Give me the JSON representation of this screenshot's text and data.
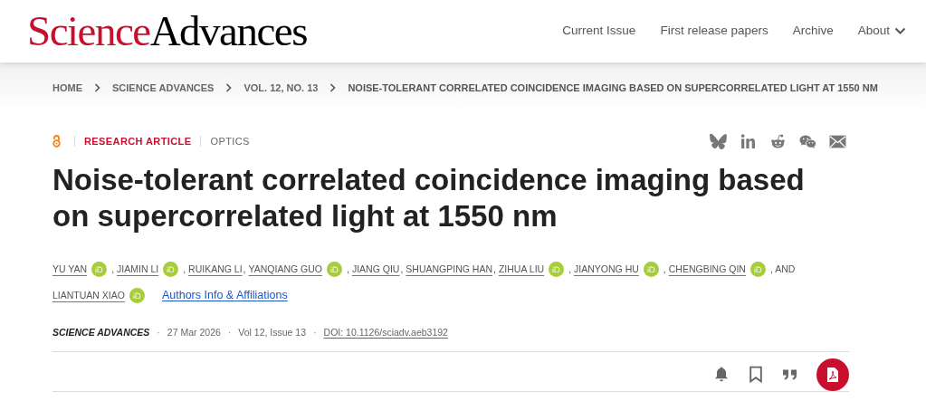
{
  "logo": {
    "part_1": "Science",
    "part_2": "Advances"
  },
  "nav": [
    {
      "label": "Current Issue",
      "kind": "link"
    },
    {
      "label": "First release papers",
      "kind": "link"
    },
    {
      "label": "Archive",
      "kind": "link"
    },
    {
      "label": "About",
      "kind": "dropdown"
    }
  ],
  "breadcrumbs": [
    "HOME",
    "SCIENCE ADVANCES",
    "VOL. 12, NO. 13",
    "NOISE-TOLERANT CORRELATED COINCIDENCE IMAGING BASED ON SUPERCORRELATED LIGHT AT 1550 NM"
  ],
  "article": {
    "open_access": true,
    "type": "RESEARCH ARTICLE",
    "subject": "OPTICS",
    "share": [
      {
        "kind": "butterfly"
      },
      {
        "kind": "linkedin"
      },
      {
        "kind": "reddit"
      },
      {
        "kind": "wechat"
      },
      {
        "kind": "email"
      }
    ],
    "title": "Noise-tolerant correlated coincidence imaging based on supercorrelated light at 1550 nm",
    "authors": [
      {
        "name": "YU YAN",
        "orcid": true,
        "separator": ","
      },
      {
        "name": "JIAMIN LI",
        "orcid": true,
        "separator": ","
      },
      {
        "name": "RUIKANG LI",
        "orcid": false,
        "separator": ","
      },
      {
        "name": "YANQIANG GUO",
        "orcid": true,
        "separator": ","
      },
      {
        "name": "JIANG QIU",
        "orcid": false,
        "separator": ","
      },
      {
        "name": "SHUANGPING HAN",
        "orcid": false,
        "separator": ","
      },
      {
        "name": "ZIHUA LIU",
        "orcid": true,
        "separator": ","
      },
      {
        "name": "JIANYONG HU",
        "orcid": true,
        "separator": ","
      },
      {
        "name": "CHENGBING QIN",
        "orcid": true,
        "separator": ", AND"
      },
      {
        "name": "LIANTUAN XIAO",
        "orcid": true
      }
    ],
    "affiliations_link": "Authors Info & Affiliations",
    "meta_separator": "·",
    "journal": "SCIENCE ADVANCES",
    "date": "27 Mar 2026",
    "volume": "Vol 12, Issue 13",
    "doi": "DOI: 10.1126/sciadv.aeb3192",
    "tools": [
      {
        "kind": "bell"
      },
      {
        "kind": "bookmark"
      },
      {
        "kind": "quote"
      },
      {
        "kind": "pdf"
      }
    ]
  }
}
